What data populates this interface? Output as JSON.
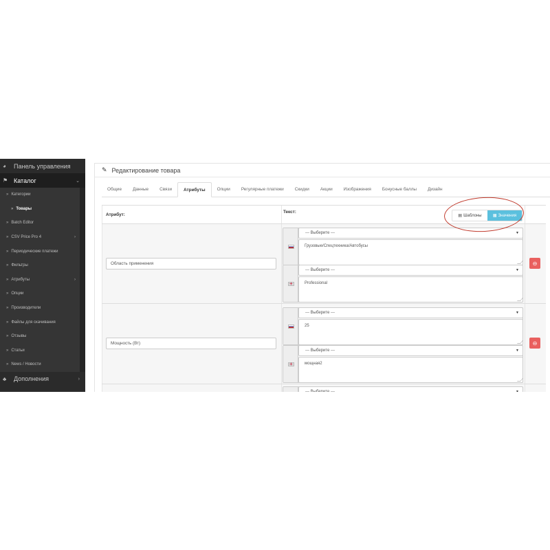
{
  "sidebar": {
    "dashboard": "Панель управления",
    "catalog": "Каталог",
    "items": [
      {
        "label": "Категории"
      },
      {
        "label": "Товары"
      },
      {
        "label": "Batch Editor"
      },
      {
        "label": "CSV Price Pro 4"
      },
      {
        "label": "Периодические платежи"
      },
      {
        "label": "Фильтры"
      },
      {
        "label": "Атрибуты"
      },
      {
        "label": "Опции"
      },
      {
        "label": "Производители"
      },
      {
        "label": "Файлы для скачивания"
      },
      {
        "label": "Отзывы"
      },
      {
        "label": "Статьи"
      },
      {
        "label": "News / Новости"
      }
    ],
    "extensions": "Дополнения"
  },
  "panel": {
    "title": "Редактирование товара",
    "tabs": [
      "Общие",
      "Данные",
      "Связи",
      "Атрибуты",
      "Опции",
      "Регулярные платежи",
      "Скидки",
      "Акции",
      "Изображения",
      "Бонусные баллы",
      "Дизайн"
    ],
    "active_tab": "Атрибуты"
  },
  "attributes": {
    "header_attribute": "Атрибут:",
    "header_text": "Текст:",
    "btn_templates": "Шаблоны",
    "btn_values": "Значения",
    "select_placeholder": "--- Выберите ---",
    "rows": [
      {
        "name": "Область применения",
        "ru_text": "Грузовые/Спецтехника/Автобусы",
        "en_text": "Professional"
      },
      {
        "name": "Мощность (Вт)",
        "ru_text": "25",
        "en_text": "мощная2"
      }
    ]
  },
  "colors": {
    "sidebar_bg": "#2f2f2f",
    "accent_info": "#5bc0de",
    "danger": "#e9605f",
    "highlight_ring": "#c0392b"
  }
}
